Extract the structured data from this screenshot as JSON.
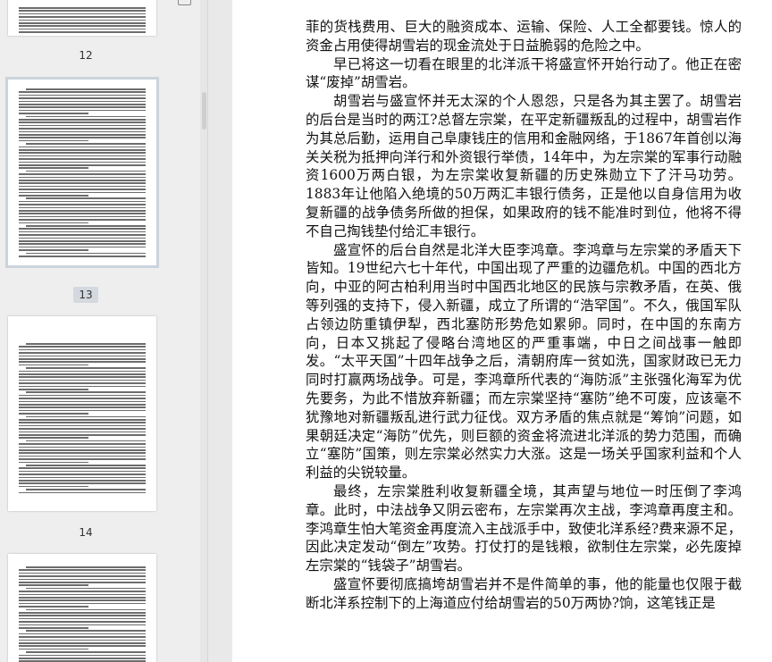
{
  "sidebar": {
    "page_numbers": [
      "12",
      "13",
      "14"
    ],
    "selected_page": "13"
  },
  "document": {
    "paragraphs": [
      {
        "indent": false,
        "text": "菲的货栈费用、巨大的融资成本、运输、保险、人工全都要钱。惊人的资金占用使得胡雪岩的现金流处于日益脆弱的危险之中。"
      },
      {
        "indent": true,
        "text": "早已将这一切看在眼里的北洋派干将盛宣怀开始行动了。他正在密谋“废掉”胡雪岩。"
      },
      {
        "indent": true,
        "text": "胡雪岩与盛宣怀并无太深的个人恩怨，只是各为其主罢了。胡雪岩的后台是当时的两江?总督左宗棠，在平定新疆叛乱的过程中，胡雪岩作为其总后勤，运用自己阜康钱庄的信用和金融网络，于1867年首创以海关关税为抵押向洋行和外资银行举债，14年中，为左宗棠的军事行动融资1600万两白银，为左宗棠收复新疆的历史殊勋立下了汗马功劳。1883年让他陷入绝境的50万两汇丰银行债务，正是他以自身信用为收复新疆的战争债务所做的担保，如果政府的钱不能准时到位，他将不得不自己掏钱垫付给汇丰银行。"
      },
      {
        "indent": true,
        "text": "盛宣怀的后台自然是北洋大臣李鸿章。李鸿章与左宗棠的矛盾天下皆知。19世纪六七十年代，中国出现了严重的边疆危机。中国的西北方向，中亚的阿古柏利用当时中国西北地区的民族与宗教矛盾，在英、俄等列强的支持下，侵入新疆，成立了所谓的“浩罕国”。不久，俄国军队占领边防重镇伊犁，西北塞防形势危如累卵。同时，在中国的东南方向，日本又挑起了侵略台湾地区的严重事端，中日之间战事一触即发。“太平天国”十四年战争之后，清朝府库一贫如洗，国家财政已无力同时打赢两场战争。可是，李鸿章所代表的“海防派”主张强化海军为优先要务，为此不惜放弃新疆；而左宗棠坚持“塞防”绝不可废，应该毫不犹豫地对新疆叛乱进行武力征伐。双方矛盾的焦点就是“筹饷”问题，如果朝廷决定“海防”优先，则巨额的资金将流进北洋派的势力范围，而确立“塞防”国策，则左宗棠必然实力大涨。这是一场关乎国家利益和个人利益的尖锐较量。"
      },
      {
        "indent": true,
        "text": "最终，左宗棠胜利收复新疆全境，其声望与地位一时压倒了李鸿章。此时，中法战争又阴云密布，左宗棠再次主战，李鸿章再度主和。李鸿章生怕大笔资金再度流入主战派手中，致使北洋系经?费来源不足，因此决定发动“倒左”攻势。打仗打的是钱粮，欲制住左宗棠，必先废掉左宗棠的“钱袋子”胡雪岩。"
      },
      {
        "indent": true,
        "text": "盛宣怀要彻底搞垮胡雪岩并不是件简单的事，他的能量也仅限于截断北洋系控制下的上海道应付给胡雪岩的50万两协?饷，这笔钱正是"
      }
    ]
  }
}
